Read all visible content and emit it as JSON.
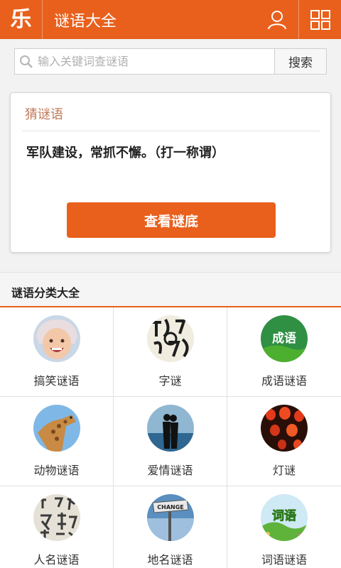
{
  "header": {
    "logo": "乐",
    "title": "谜语大全",
    "user_icon": "user-icon",
    "grid_icon": "grid-icon"
  },
  "search": {
    "placeholder": "输入关键词查谜语",
    "value": "",
    "button_label": "搜索"
  },
  "riddle_card": {
    "title": "猜谜语",
    "riddle": "军队建设，常抓不懈。（打一称谓）",
    "reveal_label": "查看谜底"
  },
  "categories_section": {
    "title": "谜语分类大全",
    "items": [
      {
        "label": "搞笑谜语",
        "image": "smiling-child-photo"
      },
      {
        "label": "字谜",
        "image": "calligraphy-letters-photo"
      },
      {
        "label": "成语谜语",
        "image": "idiom-badge-green"
      },
      {
        "label": "动物谜语",
        "image": "giraffe-photo"
      },
      {
        "label": "爱情谜语",
        "image": "couple-silhouette-photo"
      },
      {
        "label": "灯谜",
        "image": "red-lanterns-photo"
      },
      {
        "label": "人名谜语",
        "image": "chinese-characters-photo"
      },
      {
        "label": "地名谜语",
        "image": "change-sign-photo"
      },
      {
        "label": "词语谜语",
        "image": "words-badge-landscape"
      }
    ]
  },
  "colors": {
    "primary": "#e8601c",
    "background": "#f2f2f2"
  }
}
